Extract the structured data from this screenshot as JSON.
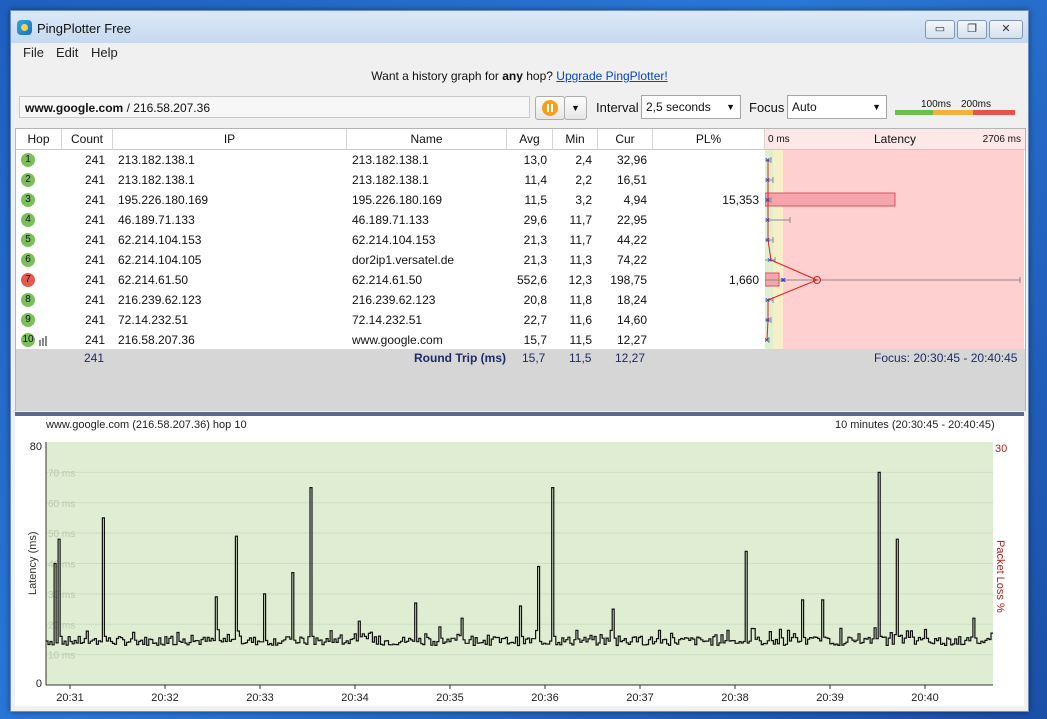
{
  "window": {
    "title": "PingPlotter Free",
    "minimize": "▭",
    "maximize": "❐",
    "close": "✕"
  },
  "menu": [
    "File",
    "Edit",
    "Help"
  ],
  "banner": {
    "prefix": "Want a history graph for ",
    "bold": "any",
    "middle": " hop? ",
    "link": "Upgrade PingPlotter!"
  },
  "target": {
    "host": "www.google.com",
    "sep": " / ",
    "ip": "216.58.207.36"
  },
  "toolbar": {
    "interval_label": "Interval",
    "interval_value": "2,5 seconds",
    "focus_label": "Focus",
    "focus_value": "Auto"
  },
  "scale_legend": {
    "t1": "100ms",
    "t2": "200ms",
    "colors": [
      "#6cbf4a",
      "#f0b23a",
      "#e5534b"
    ]
  },
  "columns": [
    "Hop",
    "Count",
    "IP",
    "Name",
    "Avg",
    "Min",
    "Cur",
    "PL%",
    "Latency"
  ],
  "latency_scale": {
    "min": "0 ms",
    "max": "2706 ms"
  },
  "hops": [
    {
      "hop": "1",
      "count": "241",
      "ip": "213.182.138.1",
      "name": "213.182.138.1",
      "avg": "13,0",
      "min": "2,4",
      "cur": "32,96",
      "pl": ""
    },
    {
      "hop": "2",
      "count": "241",
      "ip": "213.182.138.1",
      "name": "213.182.138.1",
      "avg": "11,4",
      "min": "2,2",
      "cur": "16,51",
      "pl": ""
    },
    {
      "hop": "3",
      "count": "241",
      "ip": "195.226.180.169",
      "name": "195.226.180.169",
      "avg": "11,5",
      "min": "3,2",
      "cur": "4,94",
      "pl": "15,353"
    },
    {
      "hop": "4",
      "count": "241",
      "ip": "46.189.71.133",
      "name": "46.189.71.133",
      "avg": "29,6",
      "min": "11,7",
      "cur": "22,95",
      "pl": ""
    },
    {
      "hop": "5",
      "count": "241",
      "ip": "62.214.104.153",
      "name": "62.214.104.153",
      "avg": "21,3",
      "min": "11,7",
      "cur": "44,22",
      "pl": ""
    },
    {
      "hop": "6",
      "count": "241",
      "ip": "62.214.104.105",
      "name": "dor2ip1.versatel.de",
      "avg": "21,3",
      "min": "11,3",
      "cur": "74,22",
      "pl": ""
    },
    {
      "hop": "7",
      "count": "241",
      "ip": "62.214.61.50",
      "name": "62.214.61.50",
      "avg": "552,6",
      "min": "12,3",
      "cur": "198,75",
      "pl": "1,660"
    },
    {
      "hop": "8",
      "count": "241",
      "ip": "216.239.62.123",
      "name": "216.239.62.123",
      "avg": "20,8",
      "min": "11,8",
      "cur": "18,24",
      "pl": ""
    },
    {
      "hop": "9",
      "count": "241",
      "ip": "72.14.232.51",
      "name": "72.14.232.51",
      "avg": "22,7",
      "min": "11,6",
      "cur": "14,60",
      "pl": ""
    },
    {
      "hop": "10",
      "count": "241",
      "ip": "216.58.207.36",
      "name": "www.google.com",
      "avg": "15,7",
      "min": "11,5",
      "cur": "12,27",
      "pl": ""
    }
  ],
  "summary": {
    "count": "241",
    "label": "Round Trip (ms)",
    "avg": "15,7",
    "min": "11,5",
    "cur": "12,27",
    "focus": "Focus: 20:30:45 - 20:40:45"
  },
  "history": {
    "title": "www.google.com (216.58.207.36) hop 10",
    "range": "10 minutes (20:30:45 - 20:40:45)",
    "ylabel": "Latency (ms)",
    "y2label": "Packet Loss %",
    "y_max": "80",
    "y_min": "0",
    "y2_max": "30",
    "grid_labels": [
      "70 ms",
      "60 ms",
      "50 ms",
      "40 ms",
      "30 ms",
      "20 ms",
      "10 ms"
    ],
    "times": [
      "20:31",
      "20:32",
      "20:33",
      "20:34",
      "20:35",
      "20:36",
      "20:37",
      "20:38",
      "20:39",
      "20:40"
    ],
    "spikes": [
      [
        0.008,
        40
      ],
      [
        0.012,
        48
      ],
      [
        0.06,
        55
      ],
      [
        0.18,
        29
      ],
      [
        0.2,
        49
      ],
      [
        0.23,
        30
      ],
      [
        0.26,
        37
      ],
      [
        0.28,
        65
      ],
      [
        0.33,
        21
      ],
      [
        0.39,
        27
      ],
      [
        0.44,
        22
      ],
      [
        0.5,
        26
      ],
      [
        0.52,
        39
      ],
      [
        0.535,
        65
      ],
      [
        0.56,
        18
      ],
      [
        0.6,
        25
      ],
      [
        0.63,
        16
      ],
      [
        0.66,
        17
      ],
      [
        0.72,
        18
      ],
      [
        0.74,
        44
      ],
      [
        0.8,
        28
      ],
      [
        0.82,
        28
      ],
      [
        0.88,
        70
      ],
      [
        0.9,
        48
      ],
      [
        0.98,
        22
      ]
    ]
  }
}
